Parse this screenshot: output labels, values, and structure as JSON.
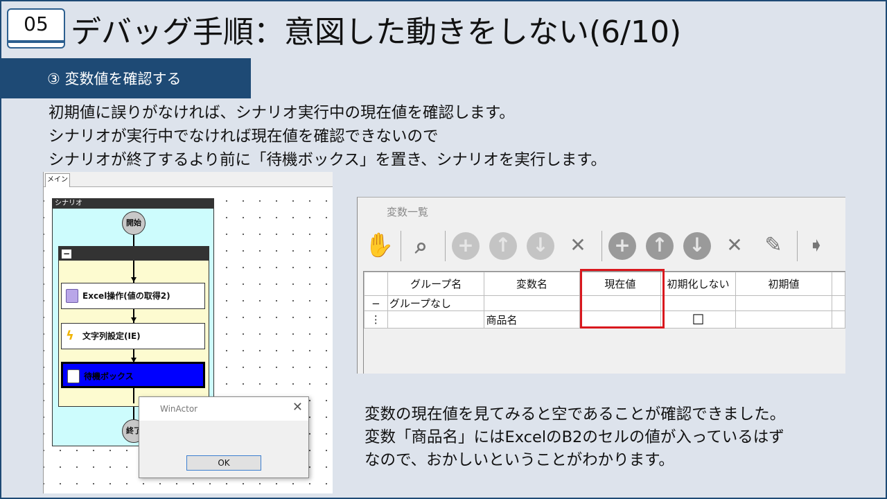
{
  "header": {
    "section_number": "05",
    "title": "デバッグ手順：意図した動きをしない(6/10)"
  },
  "section": {
    "label": "③ 変数値を確認する"
  },
  "intro_lines": [
    "初期値に誤りがなければ、シナリオ実行中の現在値を確認します。",
    "シナリオが実行中でなければ現在値を確認できないので",
    "シナリオが終了するより前に「待機ボックス」を置き、シナリオを実行します。"
  ],
  "scenario_panel": {
    "tab_label": "メイン",
    "scenario_header": "シナリオ",
    "start_label": "開始",
    "end_label": "終了",
    "group_toggle": "−",
    "nodes": [
      {
        "label": "Excel操作(値の取得2)",
        "icon": "excel-operation-icon"
      },
      {
        "label": "文字列設定(IE)",
        "icon": "lightning-icon"
      },
      {
        "label": "待機ボックス",
        "icon": "wait-box-icon"
      }
    ],
    "dialog": {
      "title": "WinActor",
      "close": "✕",
      "ok_label": "OK"
    }
  },
  "variable_list": {
    "title": "変数一覧",
    "toolbar_icons": [
      "hand-icon",
      "search-icon",
      "add-icon",
      "up-icon",
      "down-icon",
      "delete-icon",
      "add-icon",
      "up-icon",
      "down-icon",
      "delete-icon",
      "edit-icon",
      "import-icon"
    ],
    "columns": [
      "",
      "グループ名",
      "変数名",
      "現在値",
      "初期化しない",
      "初期値",
      ""
    ],
    "rows": [
      [
        "−",
        "グループなし",
        "",
        "",
        "",
        "",
        ""
      ],
      [
        "⋮",
        "",
        "商品名",
        "",
        "☐",
        "",
        ""
      ]
    ],
    "highlight_color": "#d9181e"
  },
  "conclusion_lines": [
    "変数の現在値を見てみると空であることが確認できました。",
    "変数「商品名」にはExcelのB2のセルの値が入っているはず",
    "なので、おかしいということがわかります。"
  ],
  "colors": {
    "accent": "#1e4a75",
    "background": "#dde3ec",
    "scenario_bg": "#cdfcfd",
    "group_bg": "#fdfbd0",
    "wait_node": "#0000ff"
  }
}
